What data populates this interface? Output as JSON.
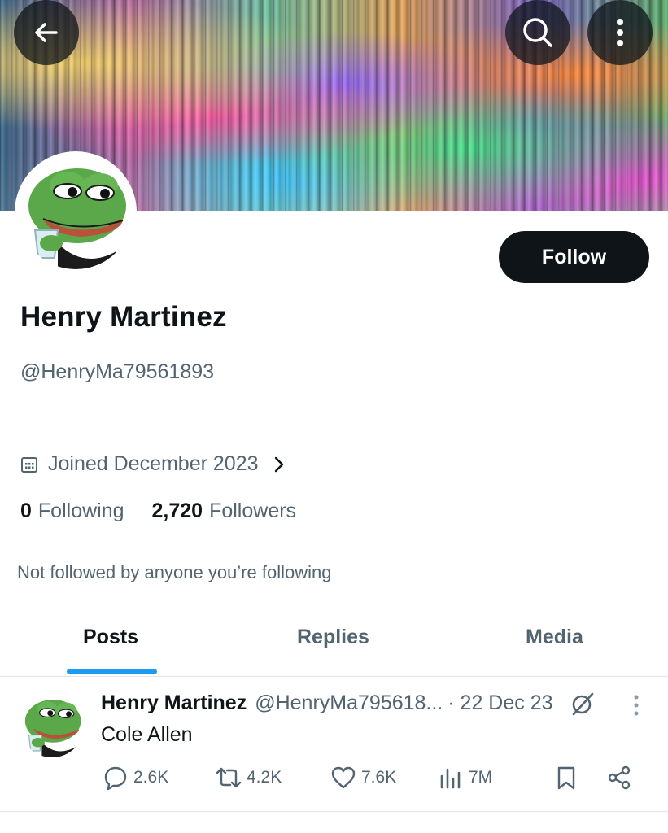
{
  "header": {
    "back_icon": "arrow-left-icon",
    "search_icon": "search-icon",
    "more_icon": "more-vertical-icon"
  },
  "profile": {
    "display_name": "Henry Martinez",
    "handle": "@HenryMa79561893",
    "follow_label": "Follow",
    "joined": "Joined December 2023",
    "following_count": "0",
    "following_label": "Following",
    "followers_count": "2,720",
    "followers_label": "Followers",
    "mutuals_note": "Not followed by anyone you’re following"
  },
  "tabs": [
    {
      "label": "Posts",
      "active": true
    },
    {
      "label": "Replies",
      "active": false
    },
    {
      "label": "Media",
      "active": false
    }
  ],
  "post": {
    "author_name": "Henry Martinez",
    "author_handle": "@HenryMa795618...",
    "date": "· 22 Dec 23",
    "text": "Cole Allen",
    "replies": "2.6K",
    "reposts": "4.2K",
    "likes": "7.6K",
    "views": "7M"
  },
  "colors": {
    "accent": "#1d9bf0",
    "text_primary": "#0f1419",
    "text_secondary": "#536471",
    "button_bg": "#0f1419"
  }
}
